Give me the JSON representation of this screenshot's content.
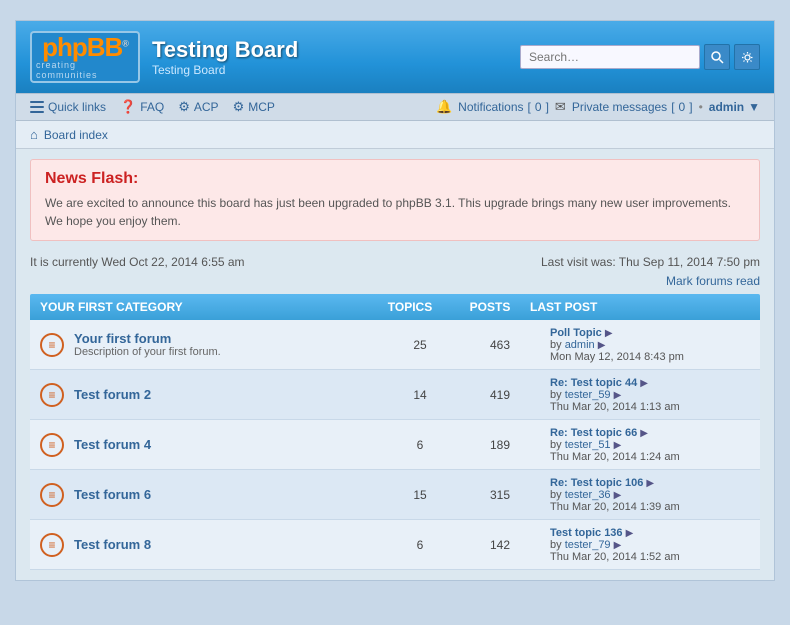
{
  "header": {
    "logo_text": "phpBB",
    "logo_reg": "®",
    "logo_sub": "creating communities",
    "board_title": "Testing Board",
    "board_subtitle": "Testing Board",
    "search_placeholder": "Search…"
  },
  "navbar": {
    "quick_links": "Quick links",
    "faq": "FAQ",
    "acp": "ACP",
    "mcp": "MCP",
    "notifications_label": "Notifications",
    "notifications_count": "0",
    "private_messages_label": "Private messages",
    "private_messages_count": "0",
    "user": "admin",
    "dot": "•"
  },
  "breadcrumb": {
    "home_label": "Board index"
  },
  "news": {
    "title": "News Flash:",
    "body": "We are excited to announce this board has just been upgraded to phpBB 3.1. This upgrade brings many new user improvements. We hope you enjoy them."
  },
  "status": {
    "current_time": "It is currently Wed Oct 22, 2014 6:55 am",
    "last_visit": "Last visit was: Thu Sep 11, 2014 7:50 pm",
    "mark_read": "Mark forums read"
  },
  "forum_section": {
    "title": "YOUR FIRST CATEGORY",
    "columns": {
      "topics": "TOPICS",
      "posts": "POSTS",
      "last_post": "LAST POST"
    },
    "forums": [
      {
        "name": "Your first forum",
        "description": "Description of your first forum.",
        "topics": "25",
        "posts": "463",
        "last_post_title": "Poll Topic",
        "last_post_user": "admin",
        "last_post_date": "Mon May 12, 2014 8:43 pm"
      },
      {
        "name": "Test forum 2",
        "description": "",
        "topics": "14",
        "posts": "419",
        "last_post_title": "Re: Test topic 44",
        "last_post_user": "tester_59",
        "last_post_date": "Thu Mar 20, 2014 1:13 am"
      },
      {
        "name": "Test forum 4",
        "description": "",
        "topics": "6",
        "posts": "189",
        "last_post_title": "Re: Test topic 66",
        "last_post_user": "tester_51",
        "last_post_date": "Thu Mar 20, 2014 1:24 am"
      },
      {
        "name": "Test forum 6",
        "description": "",
        "topics": "15",
        "posts": "315",
        "last_post_title": "Re: Test topic 106",
        "last_post_user": "tester_36",
        "last_post_date": "Thu Mar 20, 2014 1:39 am"
      },
      {
        "name": "Test forum 8",
        "description": "",
        "topics": "6",
        "posts": "142",
        "last_post_title": "Test topic 136",
        "last_post_user": "tester_79",
        "last_post_date": "Thu Mar 20, 2014 1:52 am"
      }
    ]
  }
}
